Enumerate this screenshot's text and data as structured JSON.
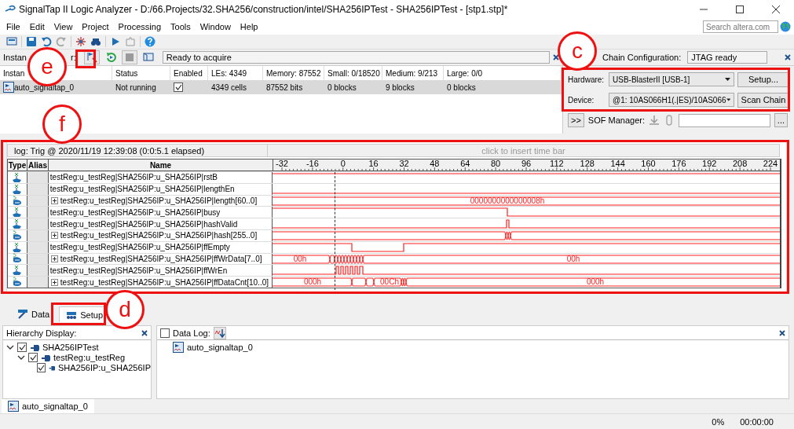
{
  "window": {
    "title": "SignalTap II Logic Analyzer - D:/66.Projects/32.SHA256/construction/intel/SHA256IPTest - SHA256IPTest - [stp1.stp]*"
  },
  "menu": [
    "File",
    "Edit",
    "View",
    "Project",
    "Processing",
    "Tools",
    "Window",
    "Help"
  ],
  "search": {
    "placeholder": "Search altera.com"
  },
  "instance_manager": {
    "label_parts": [
      "Instan",
      "r:"
    ],
    "status": "Ready to acquire"
  },
  "instance_table": {
    "columns": [
      "Instan",
      "Status",
      "Enabled",
      "LEs: 4349",
      "Memory: 87552",
      "Small: 0/18520",
      "Medium: 9/213",
      "Large: 0/0"
    ],
    "rows": [
      {
        "name": "auto_signaltap_0",
        "status": "Not running",
        "enabled": true,
        "les": "4349 cells",
        "memory": "87552 bits",
        "small": "0 blocks",
        "medium": "9 blocks",
        "large": "0 blocks",
        "selected": true
      }
    ]
  },
  "jtag": {
    "label": "Chain Configuration:",
    "status": "JTAG ready",
    "hardware_label": "Hardware:",
    "hardware": "USB-BlasterII [USB-1]",
    "setup_button": "Setup...",
    "device_label": "Device:",
    "device": "@1: 10AS066H1(.|ES)/10AS066",
    "scan_button": "Scan Chain",
    "expand_button": ">>",
    "sof_label": "SOF Manager:",
    "browse_button": "..."
  },
  "waveform": {
    "log": "log: Trig @ 2020/11/19 12:39:08 (0:0:5.1 elapsed)",
    "time_bar_hint": "click to insert time bar",
    "columns": [
      "Type",
      "Alias",
      "Name"
    ],
    "ruler": [
      "-32",
      "-16",
      "0",
      "16",
      "32",
      "48",
      "64",
      "80",
      "96",
      "112",
      "128",
      "144",
      "160",
      "176",
      "192",
      "208",
      "224"
    ],
    "signals": [
      {
        "kind": "bit",
        "name": "testReg:u_testReg|SHA256IP:u_SHA256IP|rstB"
      },
      {
        "kind": "bit",
        "name": "testReg:u_testReg|SHA256IP:u_SHA256IP|lengthEn"
      },
      {
        "kind": "bus",
        "name": "testReg:u_testReg|SHA256IP:u_SHA256IP|length[60..0]",
        "value_labels": [
          "0000000000000008h"
        ]
      },
      {
        "kind": "bit",
        "name": "testReg:u_testReg|SHA256IP:u_SHA256IP|busy"
      },
      {
        "kind": "bit",
        "name": "testReg:u_testReg|SHA256IP:u_SHA256IP|hashValid"
      },
      {
        "kind": "bus",
        "name": "testReg:u_testReg|SHA256IP:u_SHA256IP|hash[255..0]"
      },
      {
        "kind": "bit",
        "name": "testReg:u_testReg|SHA256IP:u_SHA256IP|ffEmpty"
      },
      {
        "kind": "bus",
        "name": "testReg:u_testReg|SHA256IP:u_SHA256IP|ffWrData[7..0]",
        "value_labels": [
          "00h",
          "00h"
        ]
      },
      {
        "kind": "bit",
        "name": "testReg:u_testReg|SHA256IP:u_SHA256IP|ffWrEn"
      },
      {
        "kind": "bus",
        "name": "testReg:u_testReg|SHA256IP:u_SHA256IP|ffDataCnt[10..0]",
        "value_labels": [
          "000h",
          "00Ch",
          "000h"
        ]
      }
    ]
  },
  "view_tabs": [
    {
      "label": "Data",
      "selected": false
    },
    {
      "label": "Setup",
      "selected": true
    }
  ],
  "hierarchy": {
    "title": "Hierarchy Display:",
    "tree": [
      {
        "label": "SHA256IPTest",
        "checked": true,
        "expanded": true,
        "children": [
          {
            "label": "testReg:u_testReg",
            "checked": true,
            "expanded": true,
            "children": [
              {
                "label": "SHA256IP:u_SHA256IP",
                "checked": true
              }
            ]
          }
        ]
      }
    ]
  },
  "data_log": {
    "label": "Data Log:",
    "checked": false,
    "items": [
      "auto_signaltap_0"
    ]
  },
  "file_tabs": [
    {
      "label": "auto_signaltap_0",
      "selected": true
    }
  ],
  "status_bar": {
    "progress": "0%",
    "time": "00:00:00"
  },
  "annotations": [
    {
      "label": "e"
    },
    {
      "label": "c"
    },
    {
      "label": "f"
    },
    {
      "label": "d"
    }
  ]
}
